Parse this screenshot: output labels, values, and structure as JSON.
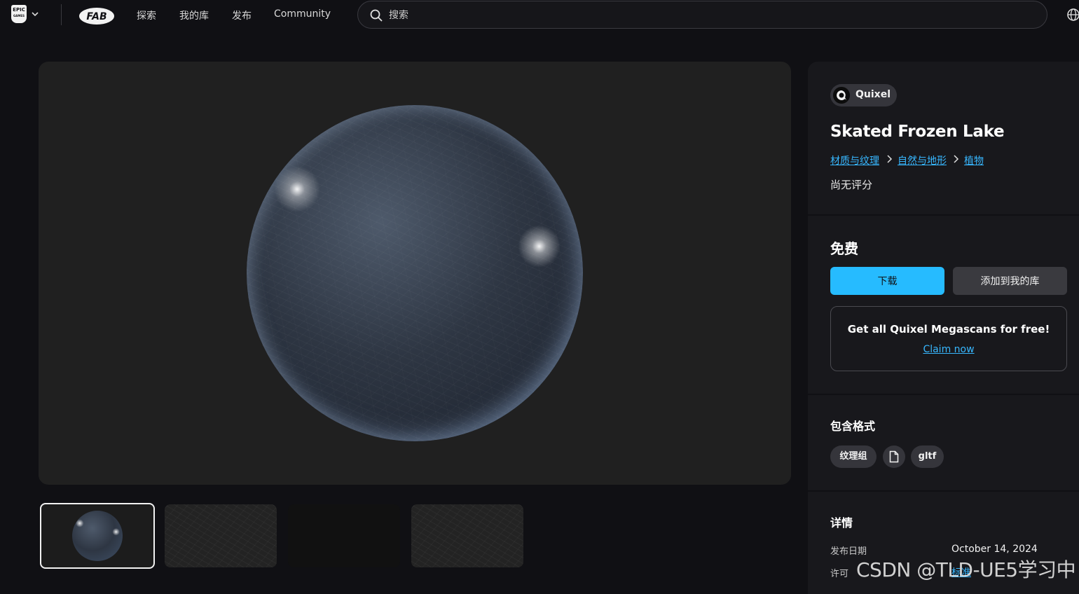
{
  "nav": {
    "epic_logo_text": "EPIC",
    "epic_logo_sub": "GAMES",
    "fab_logo_text": "FAB",
    "links": [
      "探索",
      "我的库",
      "发布",
      "Community"
    ],
    "search_placeholder": "搜索"
  },
  "gallery": {
    "thumbnails": [
      "sphere-preview",
      "texture-albedo",
      "texture-dark",
      "texture-roughness"
    ],
    "active_index": 0
  },
  "product": {
    "publisher": "Quixel",
    "title": "Skated Frozen Lake",
    "breadcrumbs": [
      "材质与纹理",
      "自然与地形",
      "植物"
    ],
    "rating": "尚无评分"
  },
  "purchase": {
    "price": "免费",
    "download_label": "下载",
    "add_library_label": "添加到我的库",
    "promo_title": "Get all Quixel Megascans for free!",
    "promo_link": "Claim now"
  },
  "formats": {
    "heading": "包含格式",
    "items": [
      "纹理组",
      "gltf"
    ]
  },
  "details": {
    "heading": "详情",
    "release_label": "发布日期",
    "release_value": "October 14, 2024",
    "license_label": "许可",
    "license_value": "标准"
  },
  "watermark": "CSDN @TLD-UE5学习中",
  "colors": {
    "background": "#101014",
    "panel": "#18181c",
    "accent": "#26bbff",
    "link": "#37b7ff"
  }
}
